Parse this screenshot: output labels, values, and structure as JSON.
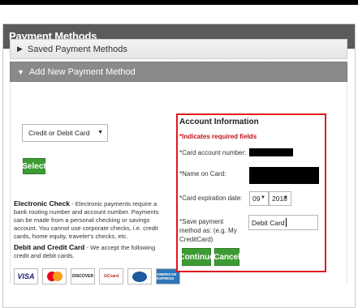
{
  "header": {
    "title": "Payment Methods"
  },
  "accordion": {
    "saved_label": "Saved Payment Methods",
    "new_label": "Add New Payment Method"
  },
  "left": {
    "method_select": {
      "value": "Credit or Debit Card"
    },
    "select_button": "Select",
    "echeck_title": "Electronic Check",
    "echeck_text": " - Electronic payments require a bank routing number and account number. Payments can be made from a personal checking or savings account. You cannot use corporate checks, i.e. credit cards, home equity, traveler's checks, etc.",
    "card_title": "Debit and Credit Card",
    "card_text": " - We accept the following credit and debit cards.",
    "cards": [
      "VISA",
      "MasterCard",
      "DISCOVER",
      "GCcard",
      "DinersClub",
      "AMERICAN EXPRESS"
    ]
  },
  "account": {
    "title": "Account Information",
    "required_note": "*Indicates required fields",
    "card_number_label": "*Card account number:",
    "name_label": "*Name on Card:",
    "expiration_label": "*Card expiration date:",
    "exp_month": "09",
    "exp_year": "2018",
    "save_as_label": "*Save payment method as: (e.g. My CreditCard)",
    "save_as_value": "Debit Card",
    "continue_button": "Continue",
    "cancel_button": "Cancel"
  },
  "colors": {
    "header_bg": "#5b5b5b",
    "button_green": "#3d9b34",
    "required_red": "#c1121f",
    "box_border": "#e0181e"
  }
}
